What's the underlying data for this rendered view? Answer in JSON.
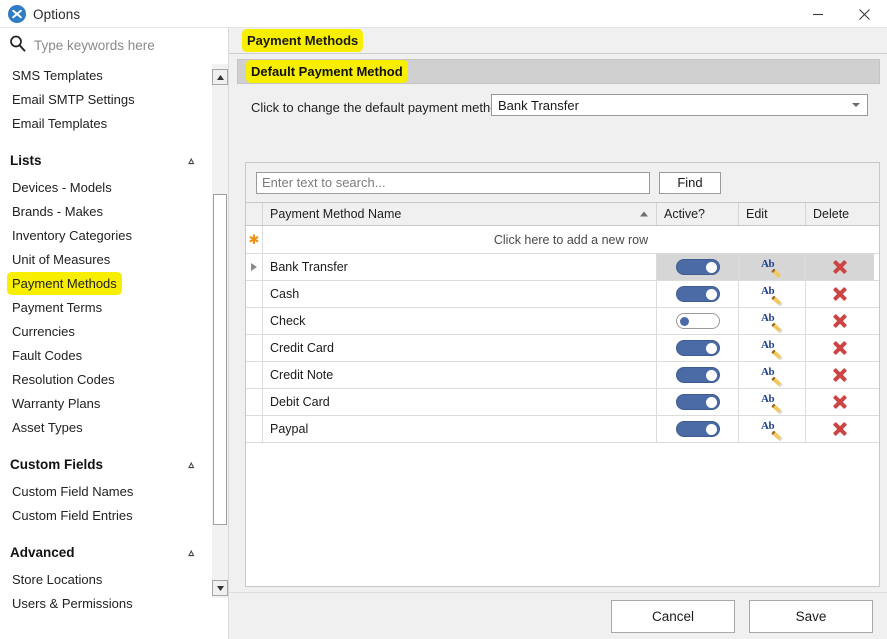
{
  "window": {
    "title": "Options",
    "icon": "tools-icon",
    "minimize_label": "Minimize",
    "close_label": "Close"
  },
  "keyword_search": {
    "placeholder": "Type keywords here",
    "value": "",
    "icon": "search-icon"
  },
  "sidebar": {
    "top_items": [
      {
        "label": "SMS Templates",
        "highlighted": false
      },
      {
        "label": "Email SMTP Settings",
        "highlighted": false
      },
      {
        "label": "Email Templates",
        "highlighted": false
      }
    ],
    "groups": [
      {
        "title": "Lists",
        "collapse_icon": "chevron-up-icon",
        "items": [
          {
            "label": "Devices - Models",
            "highlighted": false
          },
          {
            "label": "Brands - Makes",
            "highlighted": false
          },
          {
            "label": "Inventory Categories",
            "highlighted": false
          },
          {
            "label": "Unit of Measures",
            "highlighted": false
          },
          {
            "label": "Payment Methods",
            "highlighted": true
          },
          {
            "label": "Payment Terms",
            "highlighted": false
          },
          {
            "label": "Currencies",
            "highlighted": false
          },
          {
            "label": "Fault Codes",
            "highlighted": false
          },
          {
            "label": "Resolution Codes",
            "highlighted": false
          },
          {
            "label": "Warranty Plans",
            "highlighted": false
          },
          {
            "label": "Asset Types",
            "highlighted": false
          }
        ]
      },
      {
        "title": "Custom Fields",
        "collapse_icon": "chevron-up-icon",
        "items": [
          {
            "label": "Custom Field Names",
            "highlighted": false
          },
          {
            "label": "Custom Field Entries",
            "highlighted": false
          }
        ]
      },
      {
        "title": "Advanced",
        "collapse_icon": "chevron-up-icon",
        "items": [
          {
            "label": "Store Locations",
            "highlighted": false
          },
          {
            "label": "Users & Permissions",
            "highlighted": false
          }
        ]
      }
    ],
    "scrollbar": {
      "up_icon": "scroll-up-arrow-icon",
      "down_icon": "scroll-down-arrow-icon"
    }
  },
  "main": {
    "tab_label": "Payment Methods",
    "panel_title": "Default Payment Method",
    "default_method": {
      "label": "Click to change the default payment method..",
      "selected": "Bank Transfer",
      "dropdown_icon": "chevron-down-icon"
    },
    "find": {
      "placeholder": "Enter text to search...",
      "value": "",
      "button_label": "Find"
    },
    "grid": {
      "columns": [
        {
          "key": "indicator",
          "label": ""
        },
        {
          "key": "name",
          "label": "Payment Method Name",
          "sort": "ascending",
          "sort_icon": "sort-ascending-icon"
        },
        {
          "key": "active",
          "label": "Active?"
        },
        {
          "key": "edit",
          "label": "Edit"
        },
        {
          "key": "delete",
          "label": "Delete"
        }
      ],
      "new_row_text": "Click here to add a new row",
      "new_row_icon": "new-row-asterisk-icon",
      "current_row_icon": "current-row-arrow-icon",
      "edit_icon": "rename-edit-icon",
      "delete_icon": "delete-x-icon",
      "rows": [
        {
          "name": "Bank Transfer",
          "active": true,
          "current": true
        },
        {
          "name": "Cash",
          "active": true,
          "current": false
        },
        {
          "name": "Check",
          "active": false,
          "current": false
        },
        {
          "name": "Credit Card",
          "active": true,
          "current": false
        },
        {
          "name": "Credit Note",
          "active": true,
          "current": false
        },
        {
          "name": "Debit Card",
          "active": true,
          "current": false
        },
        {
          "name": "Paypal",
          "active": true,
          "current": false
        }
      ]
    }
  },
  "footer": {
    "cancel_label": "Cancel",
    "save_label": "Save"
  },
  "colors": {
    "highlight": "#f7ee00",
    "toggle_on": "#4a6ba5",
    "delete_red": "#cc4444",
    "accent_blue": "#2e7cc4",
    "asterisk_orange": "#f0900f"
  }
}
